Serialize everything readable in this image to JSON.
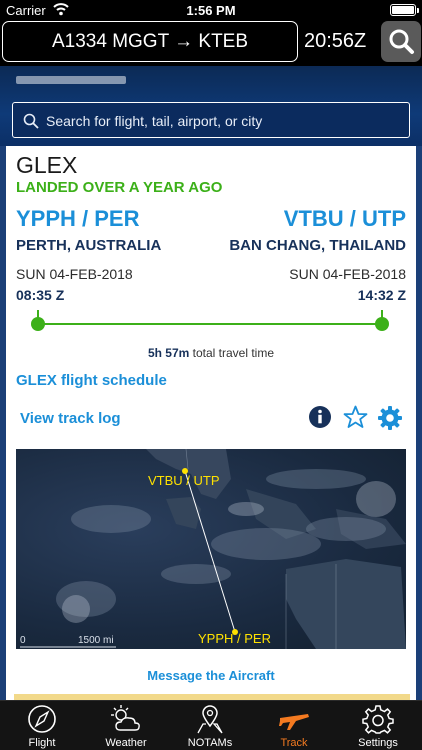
{
  "status_bar": {
    "carrier": "Carrier",
    "time": "1:56 PM"
  },
  "header": {
    "route": "A1334 MGGT → KTEB",
    "zulu_time": "20:56Z"
  },
  "search": {
    "placeholder": "Search for flight, tail, airport, or city"
  },
  "flight": {
    "aircraft": "GLEX",
    "status": "LANDED OVER A YEAR AGO",
    "origin": {
      "code": "YPPH / PER",
      "city": "PERTH, AUSTRALIA",
      "date": "SUN 04-FEB-2018",
      "time": "08:35 Z"
    },
    "destination": {
      "code": "VTBU / UTP",
      "city": "BAN CHANG, THAILAND",
      "date": "SUN 04-FEB-2018",
      "time": "14:32 Z"
    },
    "travel_duration": "5h 57m",
    "travel_label": "total travel time",
    "progress": 1.0
  },
  "links": {
    "schedule": "GLEX flight schedule",
    "track_log": "View track log",
    "message": "Message the Aircraft"
  },
  "map": {
    "origin_label": "YPPH / PER",
    "dest_label": "VTBU / UTP",
    "scale_start": "0",
    "scale_end": "1500 mi"
  },
  "tabs": [
    {
      "label": "Flight",
      "icon": "compass-icon",
      "active": false
    },
    {
      "label": "Weather",
      "icon": "weather-icon",
      "active": false
    },
    {
      "label": "NOTAMs",
      "icon": "map-pin-icon",
      "active": false
    },
    {
      "label": "Track",
      "icon": "airplane-icon",
      "active": true
    },
    {
      "label": "Settings",
      "icon": "gear-icon",
      "active": false
    }
  ],
  "colors": {
    "accent_blue": "#1b8fd8",
    "status_green": "#3cb019",
    "navy": "#17315a",
    "active_tab": "#f47a20",
    "map_label": "#ffe200"
  }
}
